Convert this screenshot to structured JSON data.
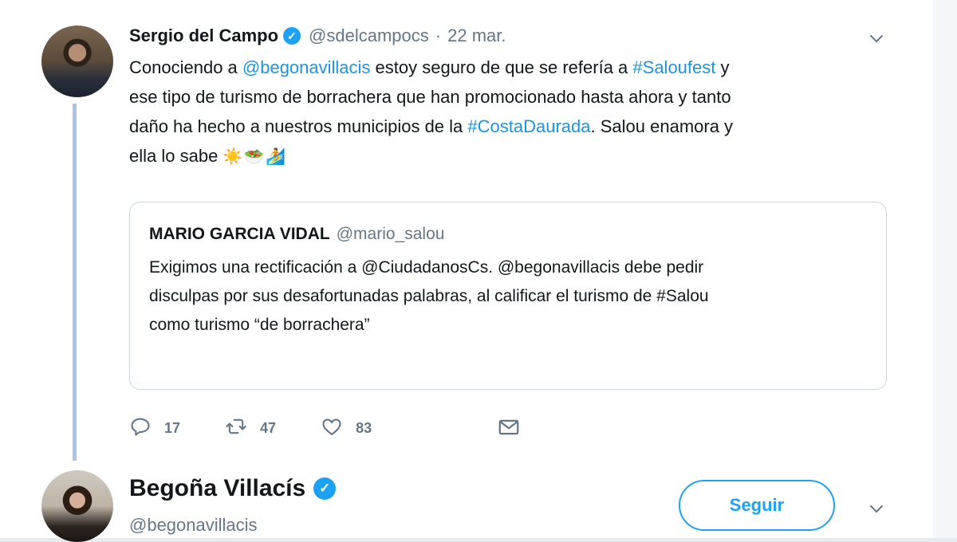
{
  "tweet": {
    "author_name": "Sergio del Campo",
    "author_handle": "@sdelcampocs",
    "separator": "·",
    "date": "22 mar.",
    "text_lines": [
      [
        {
          "t": "Conociendo a ",
          "link": false
        },
        {
          "t": "@begonavillacis",
          "link": true
        },
        {
          "t": " estoy  seguro de que se refería a ",
          "link": false
        },
        {
          "t": "#Saloufest",
          "link": true
        },
        {
          "t": " y",
          "link": false
        }
      ],
      [
        {
          "t": "ese tipo de turismo de borrachera que han promocionado hasta ahora y tanto",
          "link": false
        }
      ],
      [
        {
          "t": "daño ha hecho a nuestros municipios de la ",
          "link": false
        },
        {
          "t": "#CostaDaurada",
          "link": true
        },
        {
          "t": ". Salou enamora y",
          "link": false
        }
      ],
      [
        {
          "t": "ella lo sabe ",
          "link": false
        },
        {
          "t": "☀️🥗🏄",
          "link": false,
          "emoji": true
        }
      ]
    ],
    "quoted": {
      "name": "MARIO GARCIA VIDAL",
      "handle": "@mario_salou",
      "lines": [
        "Exigimos una rectificación a @CiudadanosCs. @begonavillacis debe pedir",
        "disculpas por sus desafortunadas palabras, al calificar el turismo de #Salou",
        "como turismo “de borrachera”"
      ]
    },
    "actions": {
      "reply_count": "17",
      "retweet_count": "47",
      "like_count": "83"
    }
  },
  "profile": {
    "name": "Begoña Villacís",
    "handle": "@begonavillacis",
    "follow_label": "Seguir"
  },
  "icons": {
    "verified": "verified-badge-icon",
    "chevron": "chevron-down-icon",
    "reply": "reply-icon",
    "retweet": "retweet-icon",
    "like": "heart-icon",
    "dm": "envelope-icon"
  },
  "colors": {
    "link": "#1b95e0",
    "accent": "#1da1f2",
    "muted": "#657786",
    "thread_line": "#aac4e9"
  }
}
